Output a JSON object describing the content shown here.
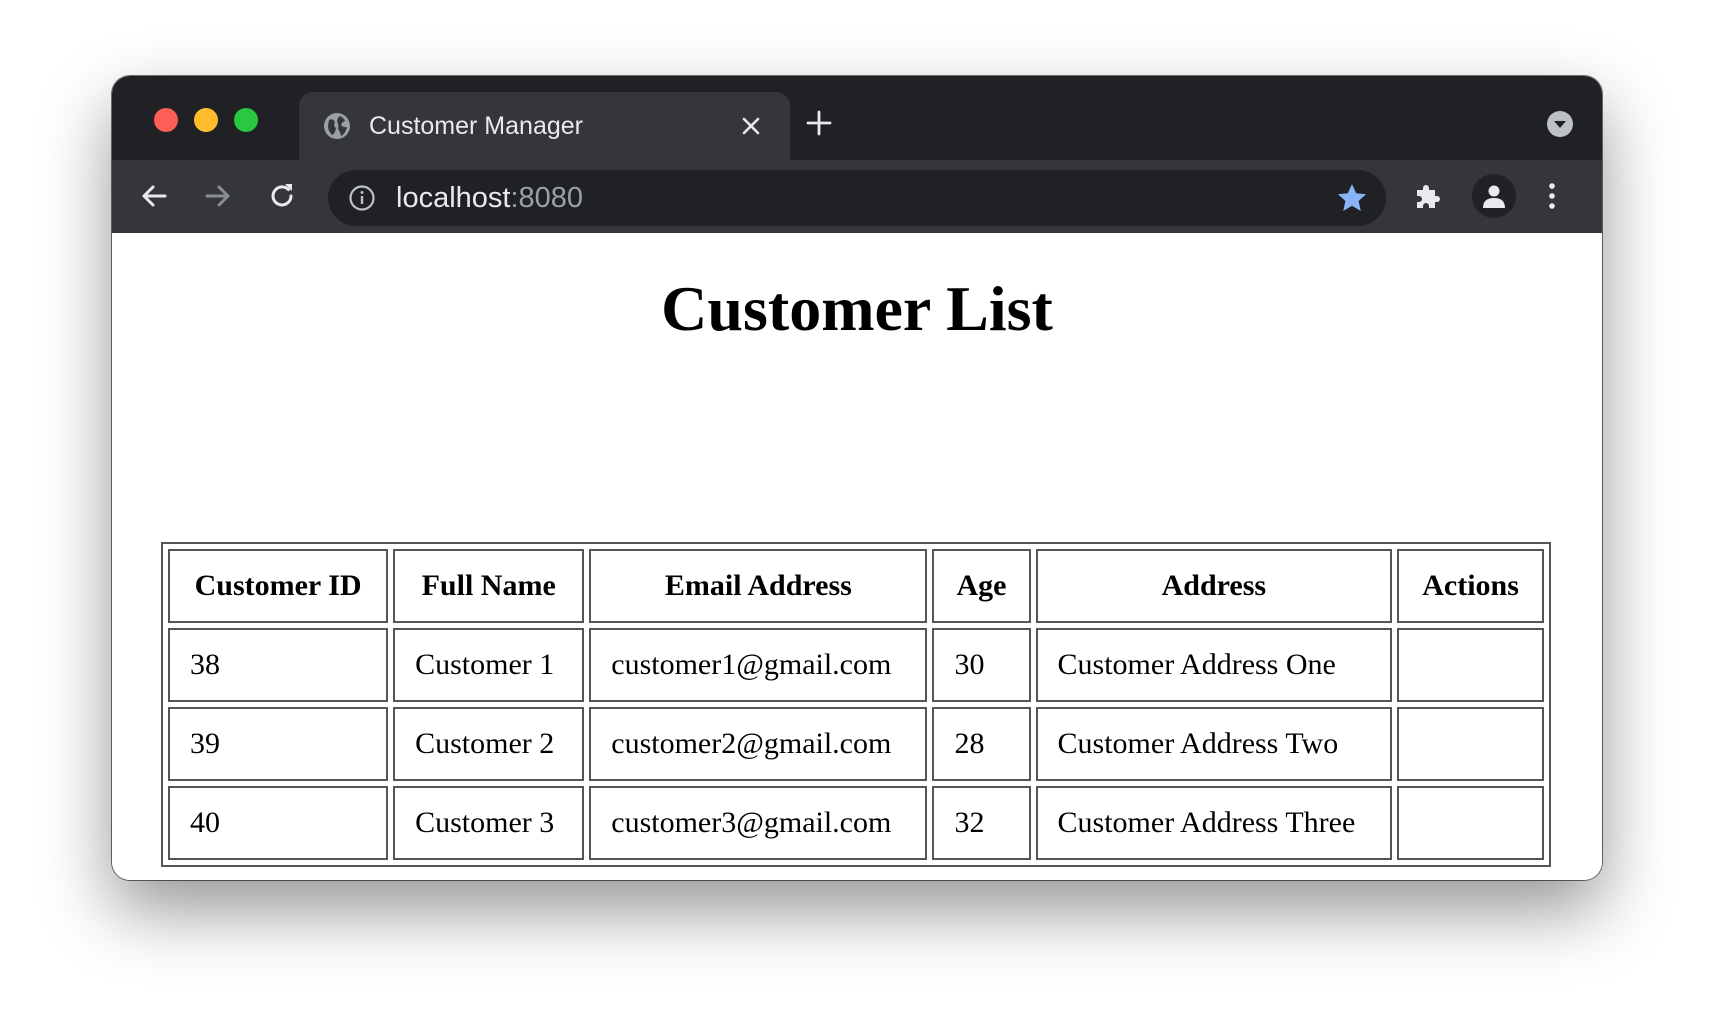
{
  "browser": {
    "tab_title": "Customer Manager",
    "url_host": "localhost",
    "url_port": ":8080",
    "accent_color": "#8ab4f8"
  },
  "icons": {
    "favicon": "globe-icon",
    "tab_close": "close-icon",
    "new_tab": "plus-icon",
    "tab_menu": "chevron-down-icon",
    "back": "arrow-left-icon",
    "forward": "arrow-right-icon",
    "reload": "reload-icon",
    "site_info": "info-icon",
    "bookmark": "star-icon",
    "extensions": "puzzle-icon",
    "profile": "person-icon",
    "menu": "kebab-icon"
  },
  "page": {
    "title": "Customer List",
    "table": {
      "headers": [
        "Customer ID",
        "Full Name",
        "Email Address",
        "Age",
        "Address",
        "Actions"
      ],
      "rows": [
        [
          "38",
          "Customer 1",
          "customer1@gmail.com",
          "30",
          "Customer Address One",
          ""
        ],
        [
          "39",
          "Customer 2",
          "customer2@gmail.com",
          "28",
          "Customer Address Two",
          ""
        ],
        [
          "40",
          "Customer 3",
          "customer3@gmail.com",
          "32",
          "Customer Address Three",
          ""
        ]
      ]
    }
  }
}
